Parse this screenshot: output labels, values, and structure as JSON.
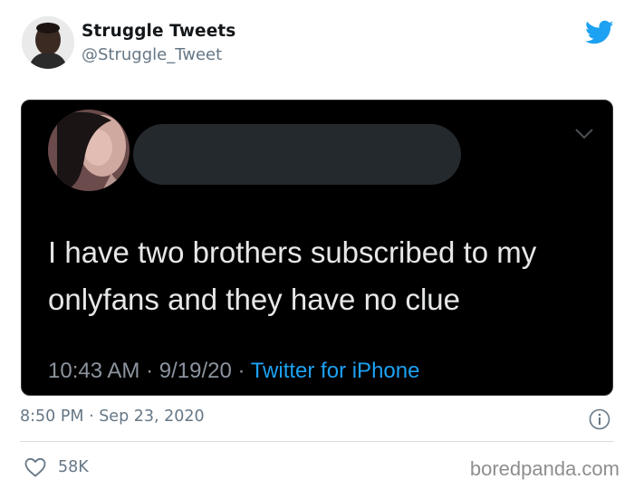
{
  "tweet": {
    "author_name": "Struggle Tweets",
    "author_handle": "@Struggle_Tweet",
    "timestamp": "8:50 PM · Sep 23, 2020",
    "likes": "58K"
  },
  "embedded": {
    "text": "I have two brothers subscribed to my onlyfans and they have no clue",
    "time": "10:43 AM · 9/19/20 · ",
    "source": "Twitter for iPhone"
  },
  "watermark": "boredpanda.com",
  "colors": {
    "twitter_blue": "#1da1f2",
    "muted": "#657786",
    "embed_bg": "#000000"
  }
}
